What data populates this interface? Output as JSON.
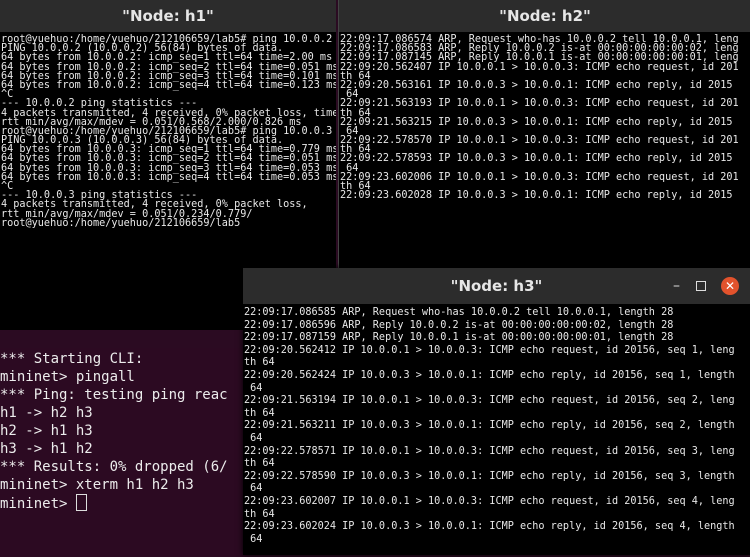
{
  "h1": {
    "title": "\"Node: h1\"",
    "lines": [
      "root@yuehuo:/home/yuehuo/212106659/lab5# ping 10.0.0.2",
      "PING 10.0.0.2 (10.0.0.2) 56(84) bytes of data.",
      "64 bytes from 10.0.0.2: icmp_seq=1 ttl=64 time=2.00 ms",
      "64 bytes from 10.0.0.2: icmp_seq=2 ttl=64 time=0.051 ms",
      "64 bytes from 10.0.0.2: icmp_seq=3 ttl=64 time=0.101 ms",
      "64 bytes from 10.0.0.2: icmp_seq=4 ttl=64 time=0.123 ms",
      "^C",
      "--- 10.0.0.2 ping statistics ---",
      "4 packets transmitted, 4 received, 0% packet loss, time",
      "rtt min/avg/max/mdev = 0.051/0.568/2.000/0.826 ms",
      "root@yuehuo:/home/yuehuo/212106659/lab5# ping 10.0.0.3",
      "PING 10.0.0.3 (10.0.0.3) 56(84) bytes of data.",
      "64 bytes from 10.0.0.3: icmp_seq=1 ttl=64 time=0.779 ms",
      "64 bytes from 10.0.0.3: icmp_seq=2 ttl=64 time=0.051 ms",
      "64 bytes from 10.0.0.3: icmp_seq=3 ttl=64 time=0.053 ms",
      "64 bytes from 10.0.0.3: icmp_seq=4 ttl=64 time=0.053 ms",
      "^C",
      "--- 10.0.0.3 ping statistics ---",
      "4 packets transmitted, 4 received, 0% packet loss,",
      "rtt min/avg/max/mdev = 0.051/0.234/0.779/",
      "root@yuehuo:/home/yuehuo/212106659/lab5"
    ]
  },
  "h2": {
    "title": "\"Node: h2\"",
    "lines": [
      "22:09:17.086574 ARP, Request who-has 10.0.0.2 tell 10.0.0.1, leng",
      "22:09:17.086583 ARP, Reply 10.0.0.2 is-at 00:00:00:00:00:02, leng",
      "22:09:17.087145 ARP, Reply 10.0.0.1 is-at 00:00:00:00:00:01, leng",
      "22:09:20.562407 IP 10.0.0.1 > 10.0.0.3: ICMP echo request, id 201",
      "th 64",
      "22:09:20.563161 IP 10.0.0.3 > 10.0.0.1: ICMP echo reply, id 2015",
      " 64",
      "22:09:21.563193 IP 10.0.0.1 > 10.0.0.3: ICMP echo request, id 201",
      "th 64",
      "22:09:21.563215 IP 10.0.0.3 > 10.0.0.1: ICMP echo reply, id 2015",
      " 64",
      "22:09:22.578570 IP 10.0.0.1 > 10.0.0.3: ICMP echo request, id 201",
      "th 64",
      "22:09:22.578593 IP 10.0.0.3 > 10.0.0.1: ICMP echo reply, id 2015",
      " 64",
      "22:09:23.602006 IP 10.0.0.1 > 10.0.0.3: ICMP echo request, id 201",
      "th 64",
      "22:09:23.602028 IP 10.0.0.3 > 10.0.0.1: ICMP echo reply, id 2015"
    ]
  },
  "mininet": {
    "lines": [
      "*** Starting CLI:",
      "mininet> pingall",
      "*** Ping: testing ping reac",
      "h1 -> h2 h3",
      "h2 -> h1 h3",
      "h3 -> h1 h2",
      "*** Results: 0% dropped (6/",
      "mininet> xterm h1 h2 h3"
    ],
    "prompt": "mininet> "
  },
  "h3": {
    "title": "\"Node: h3\"",
    "minimize": "–",
    "close": "✕",
    "lines": [
      "22:09:17.086585 ARP, Request who-has 10.0.0.2 tell 10.0.0.1, length 28",
      "22:09:17.086596 ARP, Reply 10.0.0.2 is-at 00:00:00:00:00:02, length 28",
      "22:09:17.087159 ARP, Reply 10.0.0.1 is-at 00:00:00:00:00:01, length 28",
      "22:09:20.562412 IP 10.0.0.1 > 10.0.0.3: ICMP echo request, id 20156, seq 1, leng",
      "th 64",
      "22:09:20.562424 IP 10.0.0.3 > 10.0.0.1: ICMP echo reply, id 20156, seq 1, length",
      " 64",
      "22:09:21.563194 IP 10.0.0.1 > 10.0.0.3: ICMP echo request, id 20156, seq 2, leng",
      "th 64",
      "22:09:21.563211 IP 10.0.0.3 > 10.0.0.1: ICMP echo reply, id 20156, seq 2, length",
      " 64",
      "22:09:22.578571 IP 10.0.0.1 > 10.0.0.3: ICMP echo request, id 20156, seq 3, leng",
      "th 64",
      "22:09:22.578590 IP 10.0.0.3 > 10.0.0.1: ICMP echo reply, id 20156, seq 3, length",
      " 64",
      "22:09:23.602007 IP 10.0.0.1 > 10.0.0.3: ICMP echo request, id 20156, seq 4, leng",
      "th 64",
      "22:09:23.602024 IP 10.0.0.3 > 10.0.0.1: ICMP echo reply, id 20156, seq 4, length",
      " 64"
    ]
  },
  "colors": {
    "terminal_bg": "#000000",
    "terminal_fg": "#e8e8e8",
    "titlebar_bg": "#2c2c2c",
    "ubuntu_terminal_bg": "#2c0a22",
    "close_button": "#e2522c"
  }
}
